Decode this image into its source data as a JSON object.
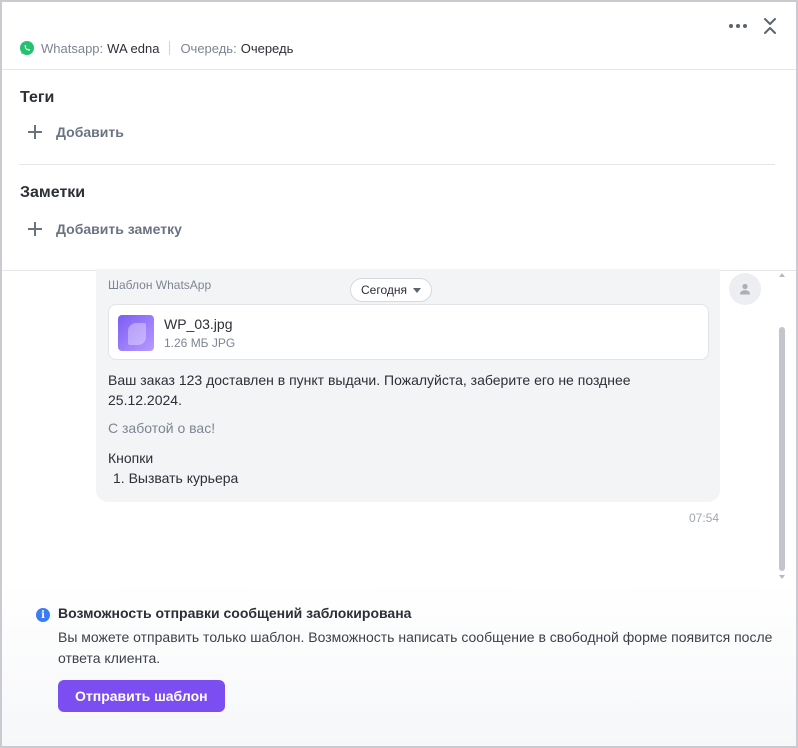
{
  "header": {
    "channel_label": "Whatsapp:",
    "channel_value": "WA edna",
    "queue_label": "Очередь:",
    "queue_value": "Очередь",
    "channel_icon": "whatsapp-icon",
    "more_icon": "more-horizontal-icon",
    "collapse_icon": "collapse-icon"
  },
  "tags": {
    "title": "Теги",
    "add_label": "Добавить"
  },
  "notes": {
    "title": "Заметки",
    "add_label": "Добавить заметку"
  },
  "chat": {
    "date_chip": "Сегодня",
    "message": {
      "template_label": "Шаблон WhatsApp",
      "file_name": "WP_03.jpg",
      "file_meta": "1.26 МБ JPG",
      "body": "Ваш заказ 123 доставлен в пункт выдачи. Пожалуйста, заберите его не позднее 25.12.2024.",
      "signature": "С заботой о вас!",
      "buttons_title": "Кнопки",
      "buttons": [
        "1. Вызвать курьера"
      ],
      "time": "07:54"
    }
  },
  "footer": {
    "blocked_title": "Возможность отправки сообщений заблокирована",
    "blocked_text": "Вы можете отправить только шаблон. Возможность написать сообщение в свободной форме появится после ответа клиента.",
    "send_template_label": "Отправить шаблон"
  },
  "colors": {
    "accent": "#7c4df1",
    "info": "#3b7cf4",
    "whatsapp": "#25c16f"
  }
}
